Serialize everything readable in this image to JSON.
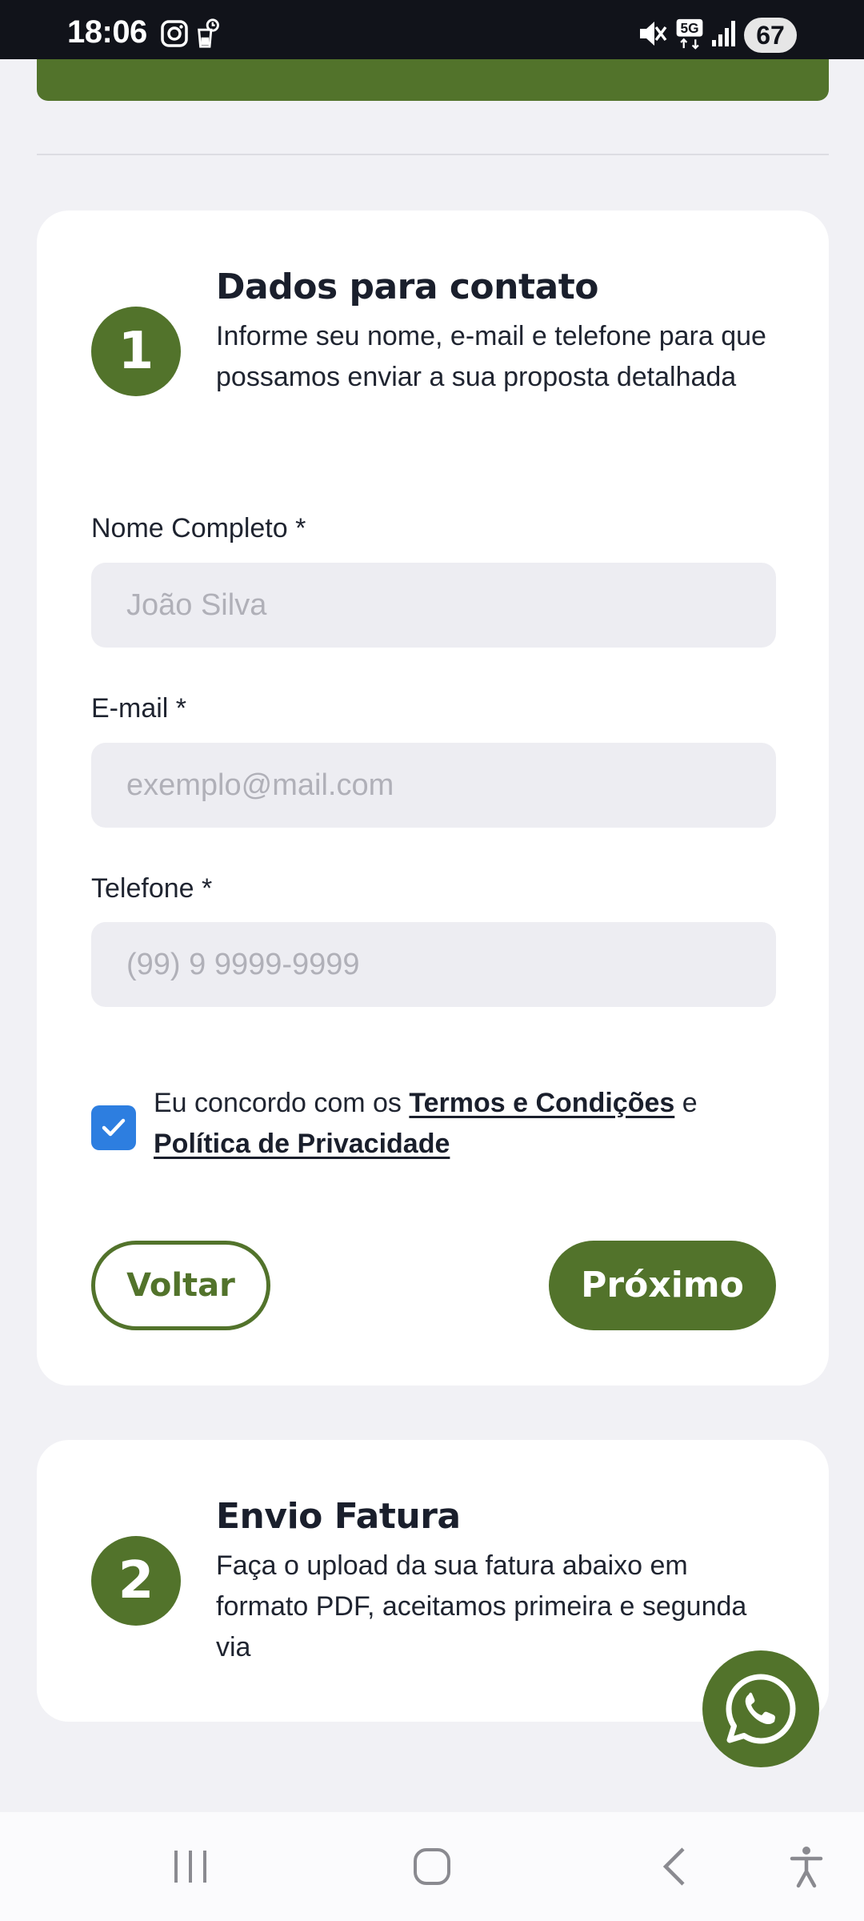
{
  "status_bar": {
    "time": "18:06",
    "battery": "67",
    "network": "5G",
    "icons": [
      "instagram-icon",
      "alarm-icon",
      "mute-icon",
      "network-5g-icon",
      "signal-icon",
      "battery-icon"
    ]
  },
  "step1": {
    "number": "1",
    "title": "Dados para contato",
    "description": "Informe seu nome, e-mail e telefone para que possamos enviar a sua proposta detalhada",
    "fields": {
      "name": {
        "label": "Nome Completo *",
        "placeholder": "João Silva",
        "value": ""
      },
      "email": {
        "label": "E-mail *",
        "placeholder": "exemplo@mail.com",
        "value": ""
      },
      "phone": {
        "label": "Telefone *",
        "placeholder": "(99) 9 9999-9999",
        "value": ""
      }
    },
    "consent": {
      "checked": true,
      "prefix": "Eu concordo com os ",
      "terms_link": "Termos e Condições",
      "middle": " e ",
      "privacy_link": "Política de Privacidade"
    },
    "back_label": "Voltar",
    "next_label": "Próximo"
  },
  "step2": {
    "number": "2",
    "title": "Envio Fatura",
    "description": "Faça o upload da sua fatura abaixo em formato PDF, aceitamos primeira e segunda via"
  },
  "colors": {
    "brand_green": "#52732b",
    "checkbox_blue": "#2d7ee0",
    "page_background": "#f1f1f5",
    "input_background": "#ededf2"
  },
  "nav_bar": {
    "icons": [
      "recent-apps-icon",
      "home-icon",
      "back-icon",
      "accessibility-icon"
    ]
  }
}
